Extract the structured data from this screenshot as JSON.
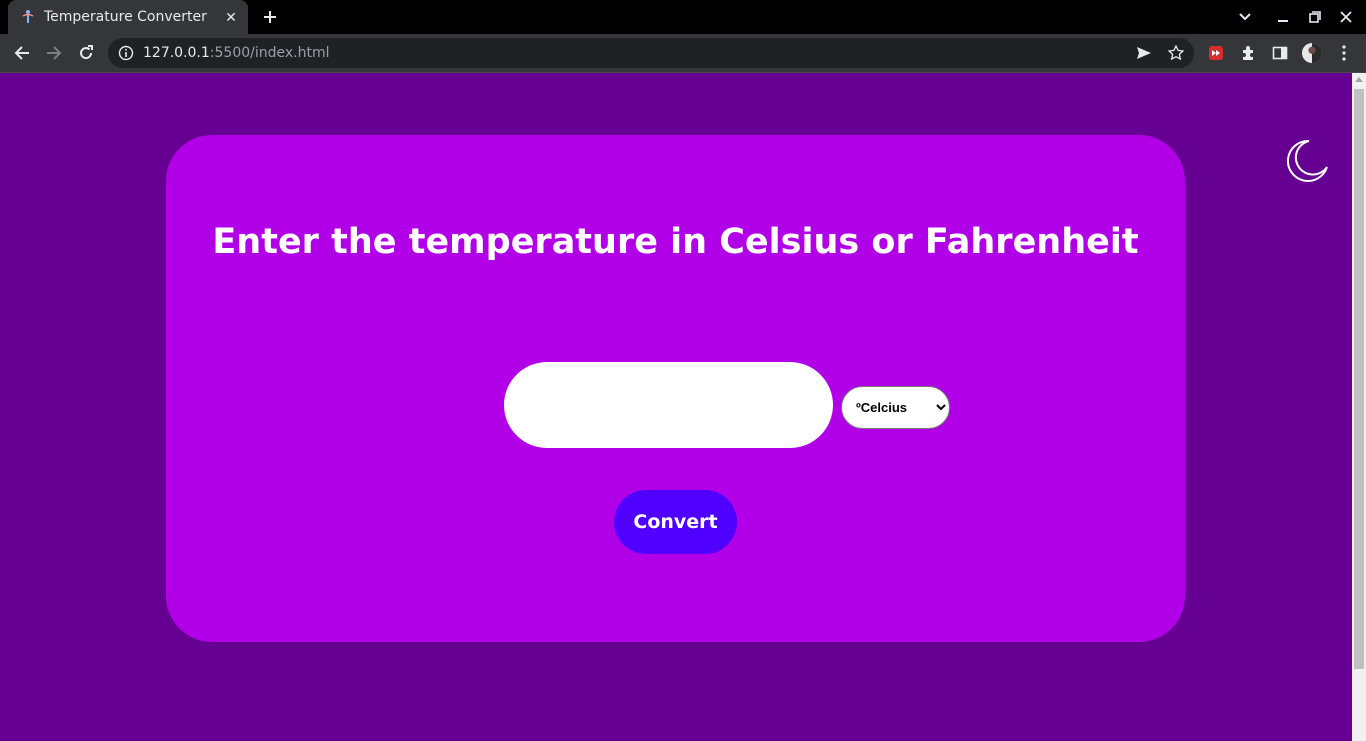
{
  "browser": {
    "tab_title": "Temperature Converter",
    "url_host": "127.0.0.1",
    "url_path": ":5500/index.html"
  },
  "page": {
    "heading": "Enter the temperature in Celsius or Fahrenheit",
    "input": {
      "value": "",
      "placeholder": ""
    },
    "unit_select": {
      "selected": "ºCelcius",
      "options": [
        "ºCelcius"
      ]
    },
    "convert_label": "Convert",
    "theme_toggle_icon": "moon-icon"
  },
  "colors": {
    "page_background": "#660092",
    "card_background": "#b100e8",
    "button_background": "#5000ff",
    "text": "#ffffff"
  }
}
